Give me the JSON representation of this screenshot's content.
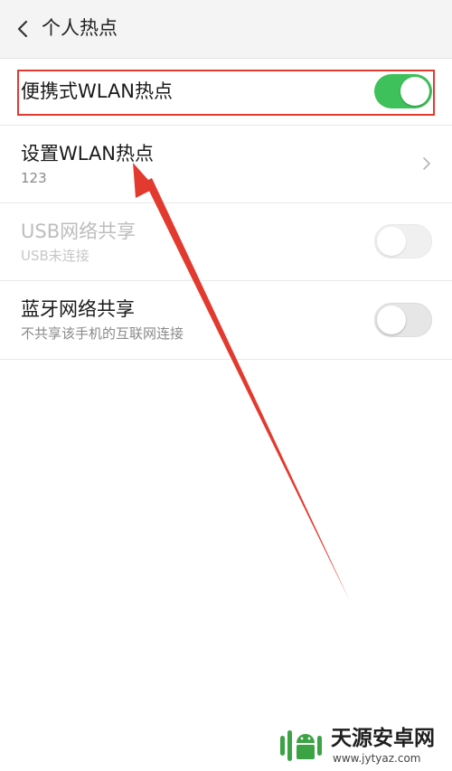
{
  "header": {
    "title": "个人热点",
    "back_icon": "chevron-left-icon"
  },
  "rows": [
    {
      "title": "便携式WLAN热点",
      "subtitle": "",
      "control": "switch",
      "state": "on",
      "enabled": true
    },
    {
      "title": "设置WLAN热点",
      "subtitle": "123",
      "control": "chevron",
      "enabled": true
    },
    {
      "title": "USB网络共享",
      "subtitle": "USB未连接",
      "control": "switch",
      "state": "off",
      "enabled": false
    },
    {
      "title": "蓝牙网络共享",
      "subtitle": "不共享该手机的互联网连接",
      "control": "switch",
      "state": "off",
      "enabled": true
    }
  ],
  "colors": {
    "switch_on": "#3ec15a",
    "switch_off": "#e6e6e6",
    "annotation_red": "#e23a2f"
  },
  "watermark": {
    "brand": "天源安卓网",
    "url": "www.jytyaz.com"
  }
}
